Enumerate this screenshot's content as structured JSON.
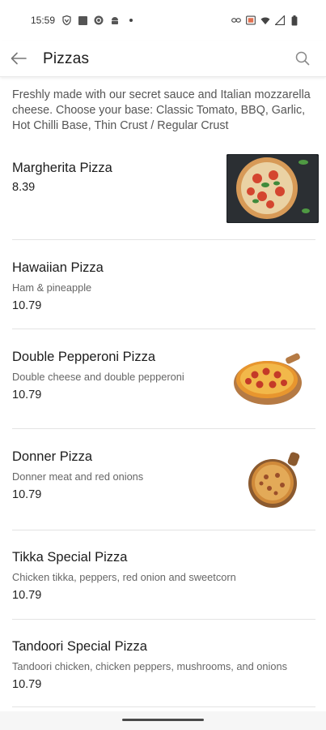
{
  "status_bar": {
    "time": "15:59",
    "left_icons": [
      "shield-icon",
      "square-icon",
      "sync-icon",
      "android-icon",
      "dot-icon"
    ],
    "right_icons": [
      "link-icon",
      "cast-icon",
      "wifi-icon",
      "signal-icon",
      "battery-icon"
    ]
  },
  "header": {
    "title": "Pizzas"
  },
  "description": "Freshly made with our secret sauce and Italian mozzarella cheese. Choose your base: Classic Tomato, BBQ, Garlic, Hot Chilli Base, Thin Crust / Regular Crust",
  "items": [
    {
      "name": "Margherita Pizza",
      "description": "",
      "price": "8.39"
    },
    {
      "name": "Hawaiian Pizza",
      "description": "Ham & pineapple",
      "price": "10.79"
    },
    {
      "name": "Double Pepperoni Pizza",
      "description": "Double cheese and double pepperoni",
      "price": "10.79"
    },
    {
      "name": "Donner Pizza",
      "description": "Donner meat and red onions",
      "price": "10.79"
    },
    {
      "name": "Tikka Special Pizza",
      "description": "Chicken tikka, peppers, red onion and sweetcorn",
      "price": "10.79"
    },
    {
      "name": "Tandoori Special Pizza",
      "description": "Tandoori chicken, chicken peppers, mushrooms, and onions",
      "price": "10.79"
    }
  ]
}
